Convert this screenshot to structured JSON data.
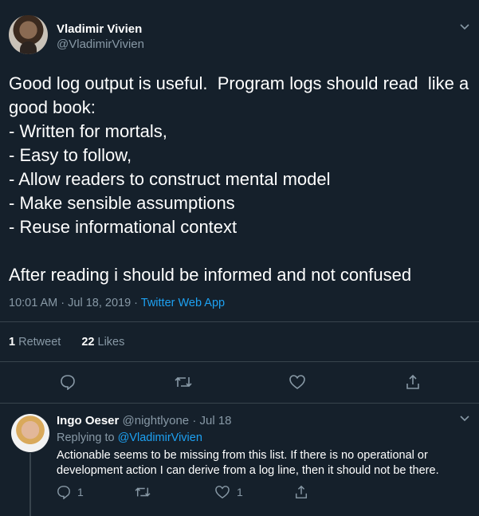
{
  "tweet": {
    "author_name": "Vladimir Vivien",
    "author_handle": "@VladimirVivien",
    "text": "Good log output is useful.  Program logs should read  like a good book:\n- Written for mortals,\n- Easy to follow,\n- Allow readers to construct mental model\n- Make sensible assumptions\n- Reuse informational context\n\nAfter reading i should be informed and not confused",
    "timestamp": "10:01 AM · Jul 18, 2019 · ",
    "source_app": "Twitter Web App",
    "retweets_count": "1",
    "retweets_label": "Retweet",
    "likes_count": "22",
    "likes_label": "Likes"
  },
  "reply": {
    "author_name": "Ingo Oeser",
    "author_handle": "@nightlyone",
    "date": "· Jul 18",
    "replying_to_prefix": "Replying to ",
    "replying_to_handle": "@VladimirVivien",
    "text": "Actionable seems to be missing from this list. If there is no operational or development action I can derive from a log line, then it should not be there.",
    "reply_count": "1",
    "like_count": "1"
  },
  "colors": {
    "background": "#15202b",
    "muted": "#8899a6",
    "accent": "#1da1f2",
    "divider": "#38444d"
  },
  "icons": [
    "chevron-down-icon",
    "reply-icon",
    "retweet-icon",
    "like-icon",
    "share-icon"
  ]
}
